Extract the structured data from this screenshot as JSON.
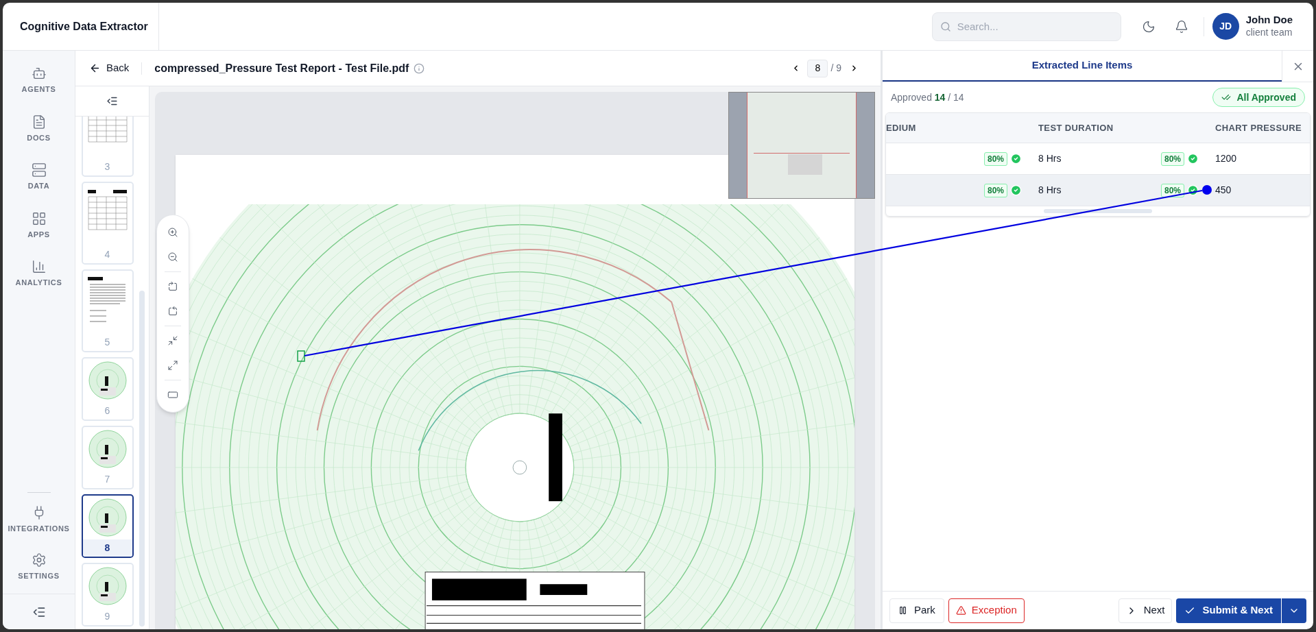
{
  "app_title": "Cognitive Data Extractor",
  "search": {
    "placeholder": "Search..."
  },
  "user": {
    "initials": "JD",
    "name": "John Doe",
    "role": "client team"
  },
  "nav": {
    "items": [
      {
        "label": "AGENTS",
        "kind": "agents"
      },
      {
        "label": "DOCS",
        "kind": "docs"
      },
      {
        "label": "DATA",
        "kind": "data"
      },
      {
        "label": "APPS",
        "kind": "apps"
      },
      {
        "label": "ANALYTICS",
        "kind": "analytics"
      }
    ],
    "bottom_items": [
      {
        "label": "INTEGRATIONS",
        "kind": "integrations"
      },
      {
        "label": "SETTINGS",
        "kind": "settings"
      }
    ]
  },
  "document": {
    "back_label": "Back",
    "filename": "compressed_Pressure Test Report - Test File.pdf",
    "page": "8",
    "page_total": "/ 9"
  },
  "thumbnails": [
    {
      "label": "3",
      "kind": "form",
      "selected": false
    },
    {
      "label": "4",
      "kind": "form",
      "selected": false
    },
    {
      "label": "5",
      "kind": "text",
      "selected": false
    },
    {
      "label": "6",
      "kind": "chart",
      "selected": false
    },
    {
      "label": "7",
      "kind": "chart",
      "selected": false
    },
    {
      "label": "8",
      "kind": "chart",
      "selected": true
    },
    {
      "label": "9",
      "kind": "chart",
      "selected": false
    }
  ],
  "panel": {
    "tab": "Extracted Line Items",
    "approved_label": "Approved",
    "approved_count": "14",
    "approved_total": "/ 14",
    "status_badge": "All Approved",
    "columns": [
      "EDIUM",
      "TEST DURATION",
      "CHART PRESSURE"
    ],
    "rows": [
      {
        "selected": false,
        "cells": [
          {
            "text": "",
            "confidence": "80%",
            "approved": true
          },
          {
            "text": "8 Hrs",
            "confidence": "80%",
            "approved": true
          },
          {
            "text": "1200"
          }
        ]
      },
      {
        "selected": true,
        "cells": [
          {
            "text": "",
            "confidence": "80%",
            "approved": true
          },
          {
            "text": "8 Hrs",
            "confidence": "80%",
            "approved": true
          },
          {
            "text": "450"
          }
        ]
      }
    ]
  },
  "actions": {
    "park": "Park",
    "exception": "Exception",
    "next": "Next",
    "submit": "Submit & Next"
  }
}
